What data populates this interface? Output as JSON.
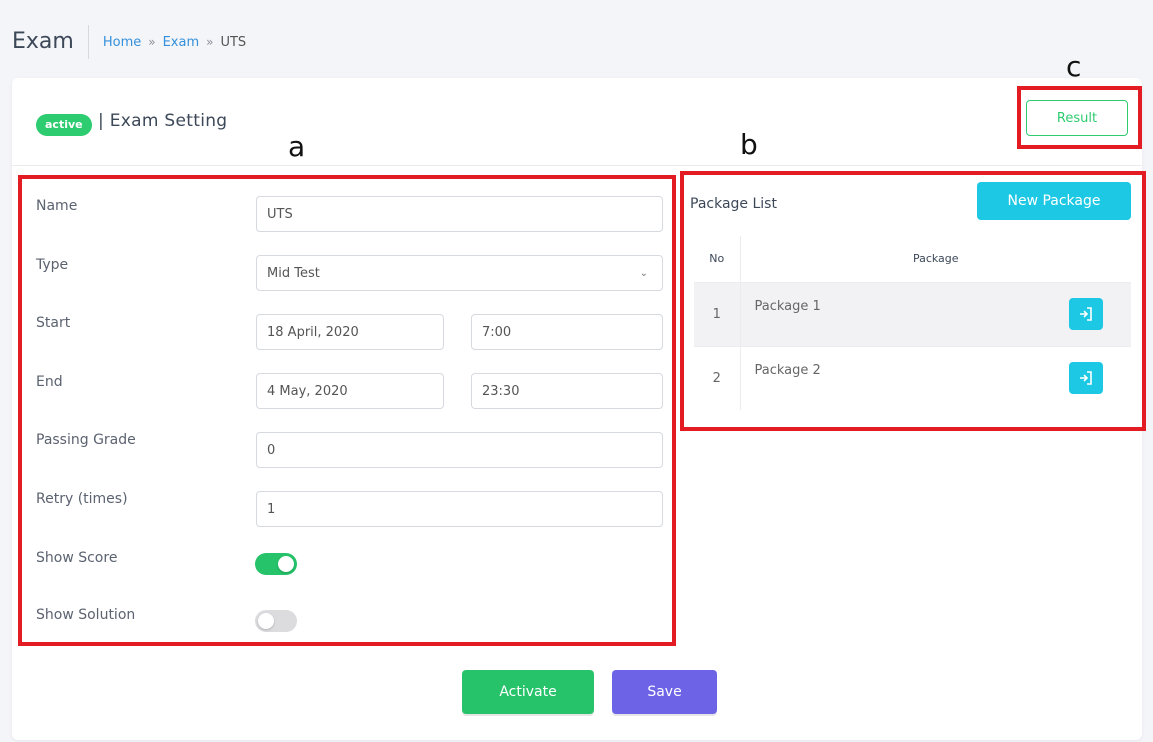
{
  "header": {
    "title": "Exam",
    "breadcrumb": [
      {
        "label": "Home"
      },
      {
        "label": "Exam"
      },
      {
        "label": "UTS"
      }
    ],
    "separator": "»"
  },
  "card": {
    "status_badge": "active",
    "title": "| Exam Setting",
    "result_button": "Result"
  },
  "annotations": {
    "a": "a",
    "b": "b",
    "c": "c"
  },
  "form": {
    "name_label": "Name",
    "name_value": "UTS",
    "type_label": "Type",
    "type_value": "Mid Test",
    "start_label": "Start",
    "start_date": "18 April, 2020",
    "start_time": "7:00",
    "end_label": "End",
    "end_date": "4 May, 2020",
    "end_time": "23:30",
    "passing_grade_label": "Passing Grade",
    "passing_grade_value": "0",
    "retry_label": "Retry (times)",
    "retry_value": "1",
    "show_score_label": "Show Score",
    "show_score_on": true,
    "show_solution_label": "Show Solution",
    "show_solution_on": false
  },
  "packages": {
    "title": "Package List",
    "new_button": "New Package",
    "col_no": "No",
    "col_package": "Package",
    "rows": [
      {
        "no": "1",
        "name": "Package 1"
      },
      {
        "no": "2",
        "name": "Package 2"
      }
    ]
  },
  "footer": {
    "activate_button": "Activate",
    "save_button": "Save"
  },
  "colors": {
    "green": "#26c36a",
    "cyan": "#1cc8e3",
    "purple": "#6c63e6",
    "annotation_red": "#e31b23"
  }
}
